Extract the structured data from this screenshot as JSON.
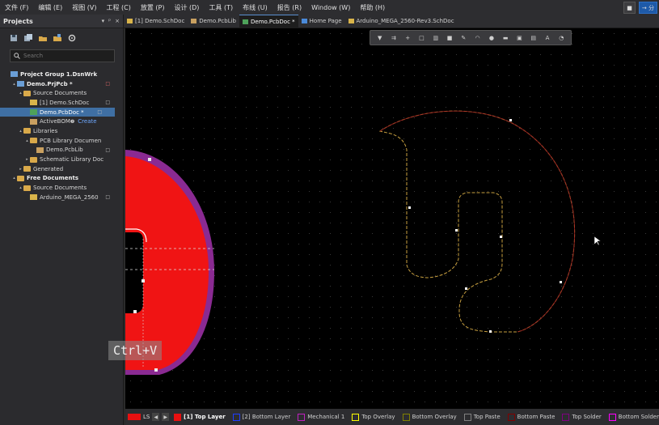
{
  "menu": [
    "文件 (F)",
    "编辑 (E)",
    "视图 (V)",
    "工程 (C)",
    "放置 (P)",
    "设计 (D)",
    "工具 (T)",
    "布线 (U)",
    "报告 (R)",
    "Window (W)",
    "帮助 (H)"
  ],
  "menu_right": {
    "btn1": "■",
    "btn2": "→ 分"
  },
  "panel": {
    "title": "Projects",
    "ctrls": [
      "▾",
      "ᵖ",
      "×"
    ],
    "search_placeholder": "Search",
    "tree": [
      {
        "label": "Project Group 1.DsnWrk",
        "indent": 0,
        "icon": "proj",
        "bold": true,
        "arrow": ""
      },
      {
        "label": "Demo.PrjPcb *",
        "indent": 1,
        "icon": "proj",
        "bold": true,
        "arrow": "▴",
        "badge": "□",
        "badge_red": true
      },
      {
        "label": "Source Documents",
        "indent": 2,
        "icon": "folder",
        "arrow": "▴"
      },
      {
        "label": "[1] Demo.SchDoc",
        "indent": 3,
        "icon": "doc-sch",
        "arrow": "",
        "badge": "□"
      },
      {
        "label": "Demo.PcbDoc *",
        "indent": 3,
        "icon": "doc-pcb",
        "arrow": "",
        "badge": "□",
        "selected": true
      },
      {
        "label": "ActiveBOM",
        "indent": 3,
        "icon": "doc-lib",
        "arrow": "",
        "extra": "Create"
      },
      {
        "label": "Libraries",
        "indent": 2,
        "icon": "folder",
        "arrow": "▴"
      },
      {
        "label": "PCB Library Documen",
        "indent": 3,
        "icon": "folder",
        "arrow": "▴"
      },
      {
        "label": "Demo.PcbLib",
        "indent": 4,
        "icon": "doc-lib",
        "arrow": "",
        "badge": "□"
      },
      {
        "label": "Schematic Library Doc",
        "indent": 3,
        "icon": "folder",
        "arrow": "▸"
      },
      {
        "label": "Generated",
        "indent": 2,
        "icon": "folder",
        "arrow": "▸"
      },
      {
        "label": "Free Documents",
        "indent": 1,
        "icon": "folder",
        "bold": true,
        "arrow": "▴"
      },
      {
        "label": "Source Documents",
        "indent": 2,
        "icon": "folder",
        "arrow": "▴"
      },
      {
        "label": "Arduino_MEGA_2560",
        "indent": 3,
        "icon": "doc-sch",
        "arrow": "",
        "badge": "□"
      }
    ]
  },
  "tabs": [
    {
      "label": "[1] Demo.SchDoc",
      "color": "#d9b44a",
      "active": false
    },
    {
      "label": "Demo.PcbLib",
      "color": "#c9a060",
      "active": false
    },
    {
      "label": "Demo.PcbDoc *",
      "color": "#4ea25a",
      "active": true
    },
    {
      "label": "Home Page",
      "color": "#4a8ad9",
      "active": false
    },
    {
      "label": "Arduino_MEGA_2560-Rev3.SchDoc",
      "color": "#d9b44a",
      "active": false
    }
  ],
  "float_toolbar": [
    "▼",
    "⇉",
    "+",
    "□",
    "▥",
    "■",
    "✎",
    "◠",
    "●",
    "▬",
    "▣",
    "▤",
    "A",
    "◔"
  ],
  "overlay_hint": "Ctrl+V",
  "layerbar": {
    "ls_label": "LS",
    "ls_color": "#e81010",
    "layers": [
      {
        "label": "[1] Top Layer",
        "color": "#e81010",
        "active": true
      },
      {
        "label": "[2] Bottom Layer",
        "color": "#1e3cff",
        "active": false
      },
      {
        "label": "Mechanical 1",
        "color": "#c020c0",
        "active": false
      },
      {
        "label": "Top Overlay",
        "color": "#ffff00",
        "active": false
      },
      {
        "label": "Bottom Overlay",
        "color": "#808000",
        "active": false
      },
      {
        "label": "Top Paste",
        "color": "#808080",
        "active": false
      },
      {
        "label": "Bottom Paste",
        "color": "#800000",
        "active": false
      },
      {
        "label": "Top Solder",
        "color": "#800080",
        "active": false
      },
      {
        "label": "Bottom Solder",
        "color": "#ff00ff",
        "active": false
      }
    ]
  },
  "colors": {
    "accent": "#3f6fa3",
    "copper": "#e81010",
    "keepout": "#b02a8a"
  }
}
